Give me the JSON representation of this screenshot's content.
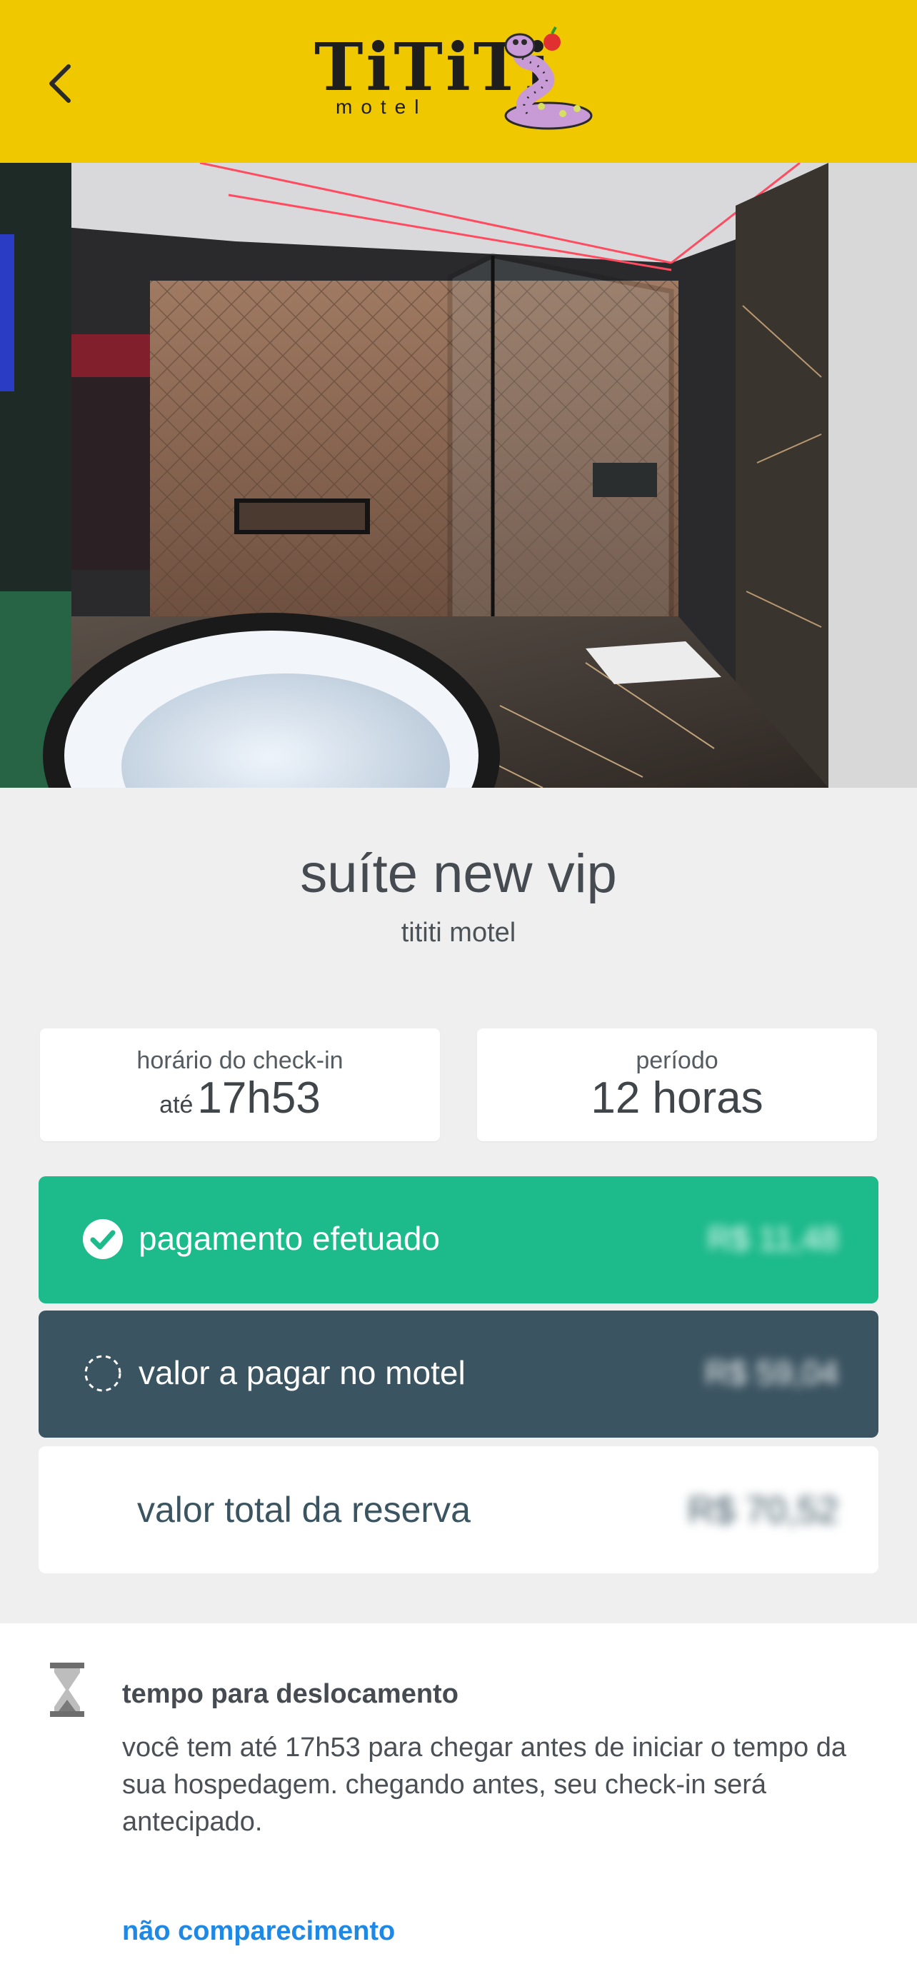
{
  "header": {
    "logo_text": "TiTiTi",
    "logo_subtext": "motel",
    "back_icon": "chevron-left-icon",
    "background_color": "#f0c800"
  },
  "suite": {
    "name": "suíte new vip",
    "motel": "tititi motel"
  },
  "checkin": {
    "label": "horário do check-in",
    "prefix": "até",
    "time": "17h53"
  },
  "period": {
    "label": "período",
    "value": "12 horas"
  },
  "payment": {
    "paid_label": "pagamento efetuado",
    "paid_amount": "R$ 11,48",
    "paid_color": "#1dba8b",
    "due_label": "valor a pagar no motel",
    "due_amount": "R$ 59,04",
    "due_color": "#3b5461",
    "total_label": "valor total da reserva",
    "total_amount": "R$ 70,52"
  },
  "travel": {
    "title": "tempo para deslocamento",
    "description": "você tem até 17h53 para chegar antes de iniciar o tempo da sua hospedagem. chegando antes, seu check-in será antecipado.",
    "icon": "hourglass-icon",
    "no_show_link": "não comparecimento",
    "link_color": "#1e88e5"
  }
}
